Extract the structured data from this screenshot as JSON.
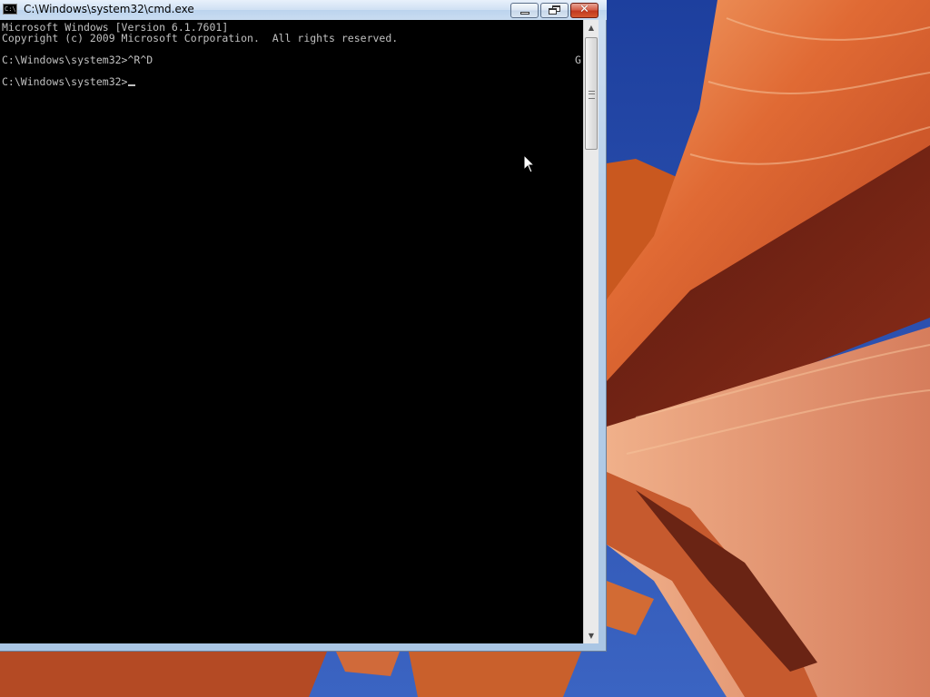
{
  "window": {
    "title": "C:\\Windows\\system32\\cmd.exe",
    "icon_text": "C:\\",
    "buttons": {
      "minimize": "minimize-icon",
      "restore": "restore-icon",
      "close": "close-icon"
    },
    "close_glyph": "✕"
  },
  "console": {
    "lines": [
      "Microsoft Windows [Version 6.1.7601]",
      "Copyright (c) 2009 Microsoft Corporation.  All rights reserved.",
      "",
      "C:\\Windows\\system32>^R^D",
      "",
      "C:\\Windows\\system32>"
    ],
    "right_edge_char": "G",
    "colors": {
      "background": "#000000",
      "text": "#c0c0c0"
    }
  },
  "scrollbar": {
    "position_fraction": 0.0,
    "visible_fraction": 0.18
  },
  "colors": {
    "close_button": "#c2391f",
    "title_bar": "#bcd4ee",
    "wallpaper_rock": "#e0703a",
    "wallpaper_sky": "#2a4fa8"
  }
}
